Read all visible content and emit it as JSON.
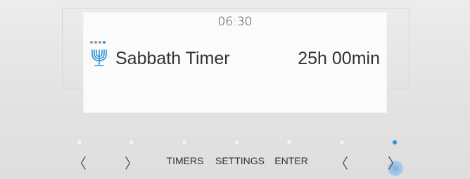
{
  "display": {
    "time": "06:30",
    "page_indicator": {
      "total": 4,
      "active_index": 3
    },
    "program": {
      "icon": "menorah-icon",
      "label": "Sabbath Timer",
      "value": "25h 00min"
    }
  },
  "controls": {
    "buttons": [
      {
        "label": "〈",
        "name": "left-arrow-button",
        "led_on": false
      },
      {
        "label": "〉",
        "name": "right-arrow-button",
        "led_on": false
      },
      {
        "label": "TIMERS",
        "name": "timers-button",
        "led_on": false
      },
      {
        "label": "SETTINGS",
        "name": "settings-button",
        "led_on": false
      },
      {
        "label": "ENTER",
        "name": "enter-button",
        "led_on": false
      },
      {
        "label": "〈",
        "name": "decrease-button",
        "led_on": false
      },
      {
        "label": "〉",
        "name": "increase-button",
        "led_on": true
      }
    ]
  },
  "colors": {
    "accent": "#2e8fd4",
    "panel": "#e6e6e6",
    "screen": "#fbfbfb"
  }
}
